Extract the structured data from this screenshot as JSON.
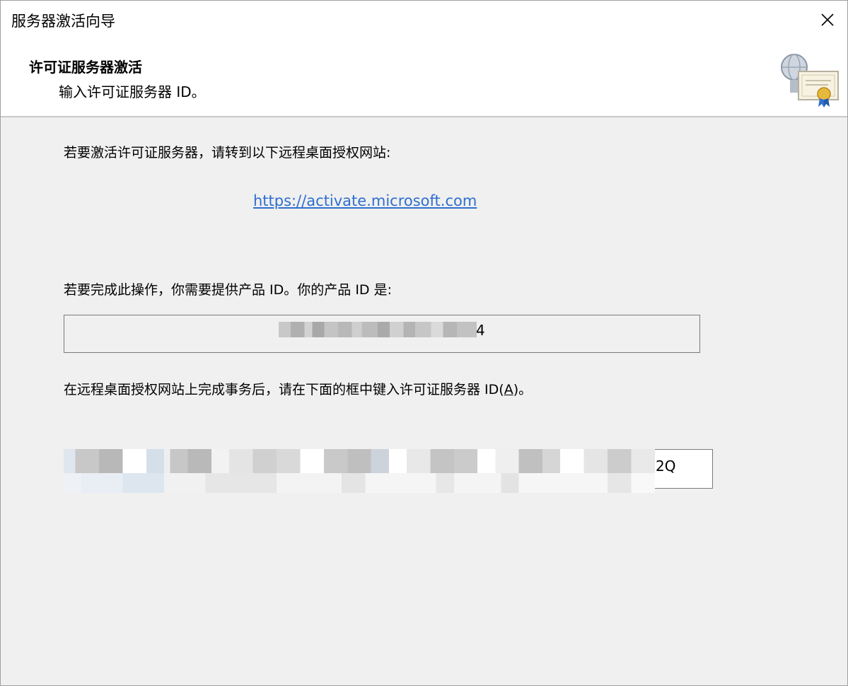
{
  "window": {
    "title": "服务器激活向导"
  },
  "header": {
    "title": "许可证服务器激活",
    "subtitle": "输入许可证服务器 ID。"
  },
  "content": {
    "instruction_1": "若要激活许可证服务器，请转到以下远程桌面授权网站:",
    "link": "https://activate.microsoft.com",
    "instruction_2": "若要完成此操作，你需要提供产品 ID。你的产品 ID 是:",
    "product_id_visible_suffix": "4",
    "instruction_3_prefix": "在远程桌面授权网站上完成事务后，请在下面的框中键入许可证服务器 ID(",
    "instruction_3_accel": "A",
    "instruction_3_suffix": ")。",
    "server_id_visible_suffix": "2Q"
  },
  "icons": {
    "close": "close-icon",
    "header_graphic": "certificate-server-icon"
  },
  "colors": {
    "link": "#2f6fcf",
    "background": "#f0f0f0"
  }
}
